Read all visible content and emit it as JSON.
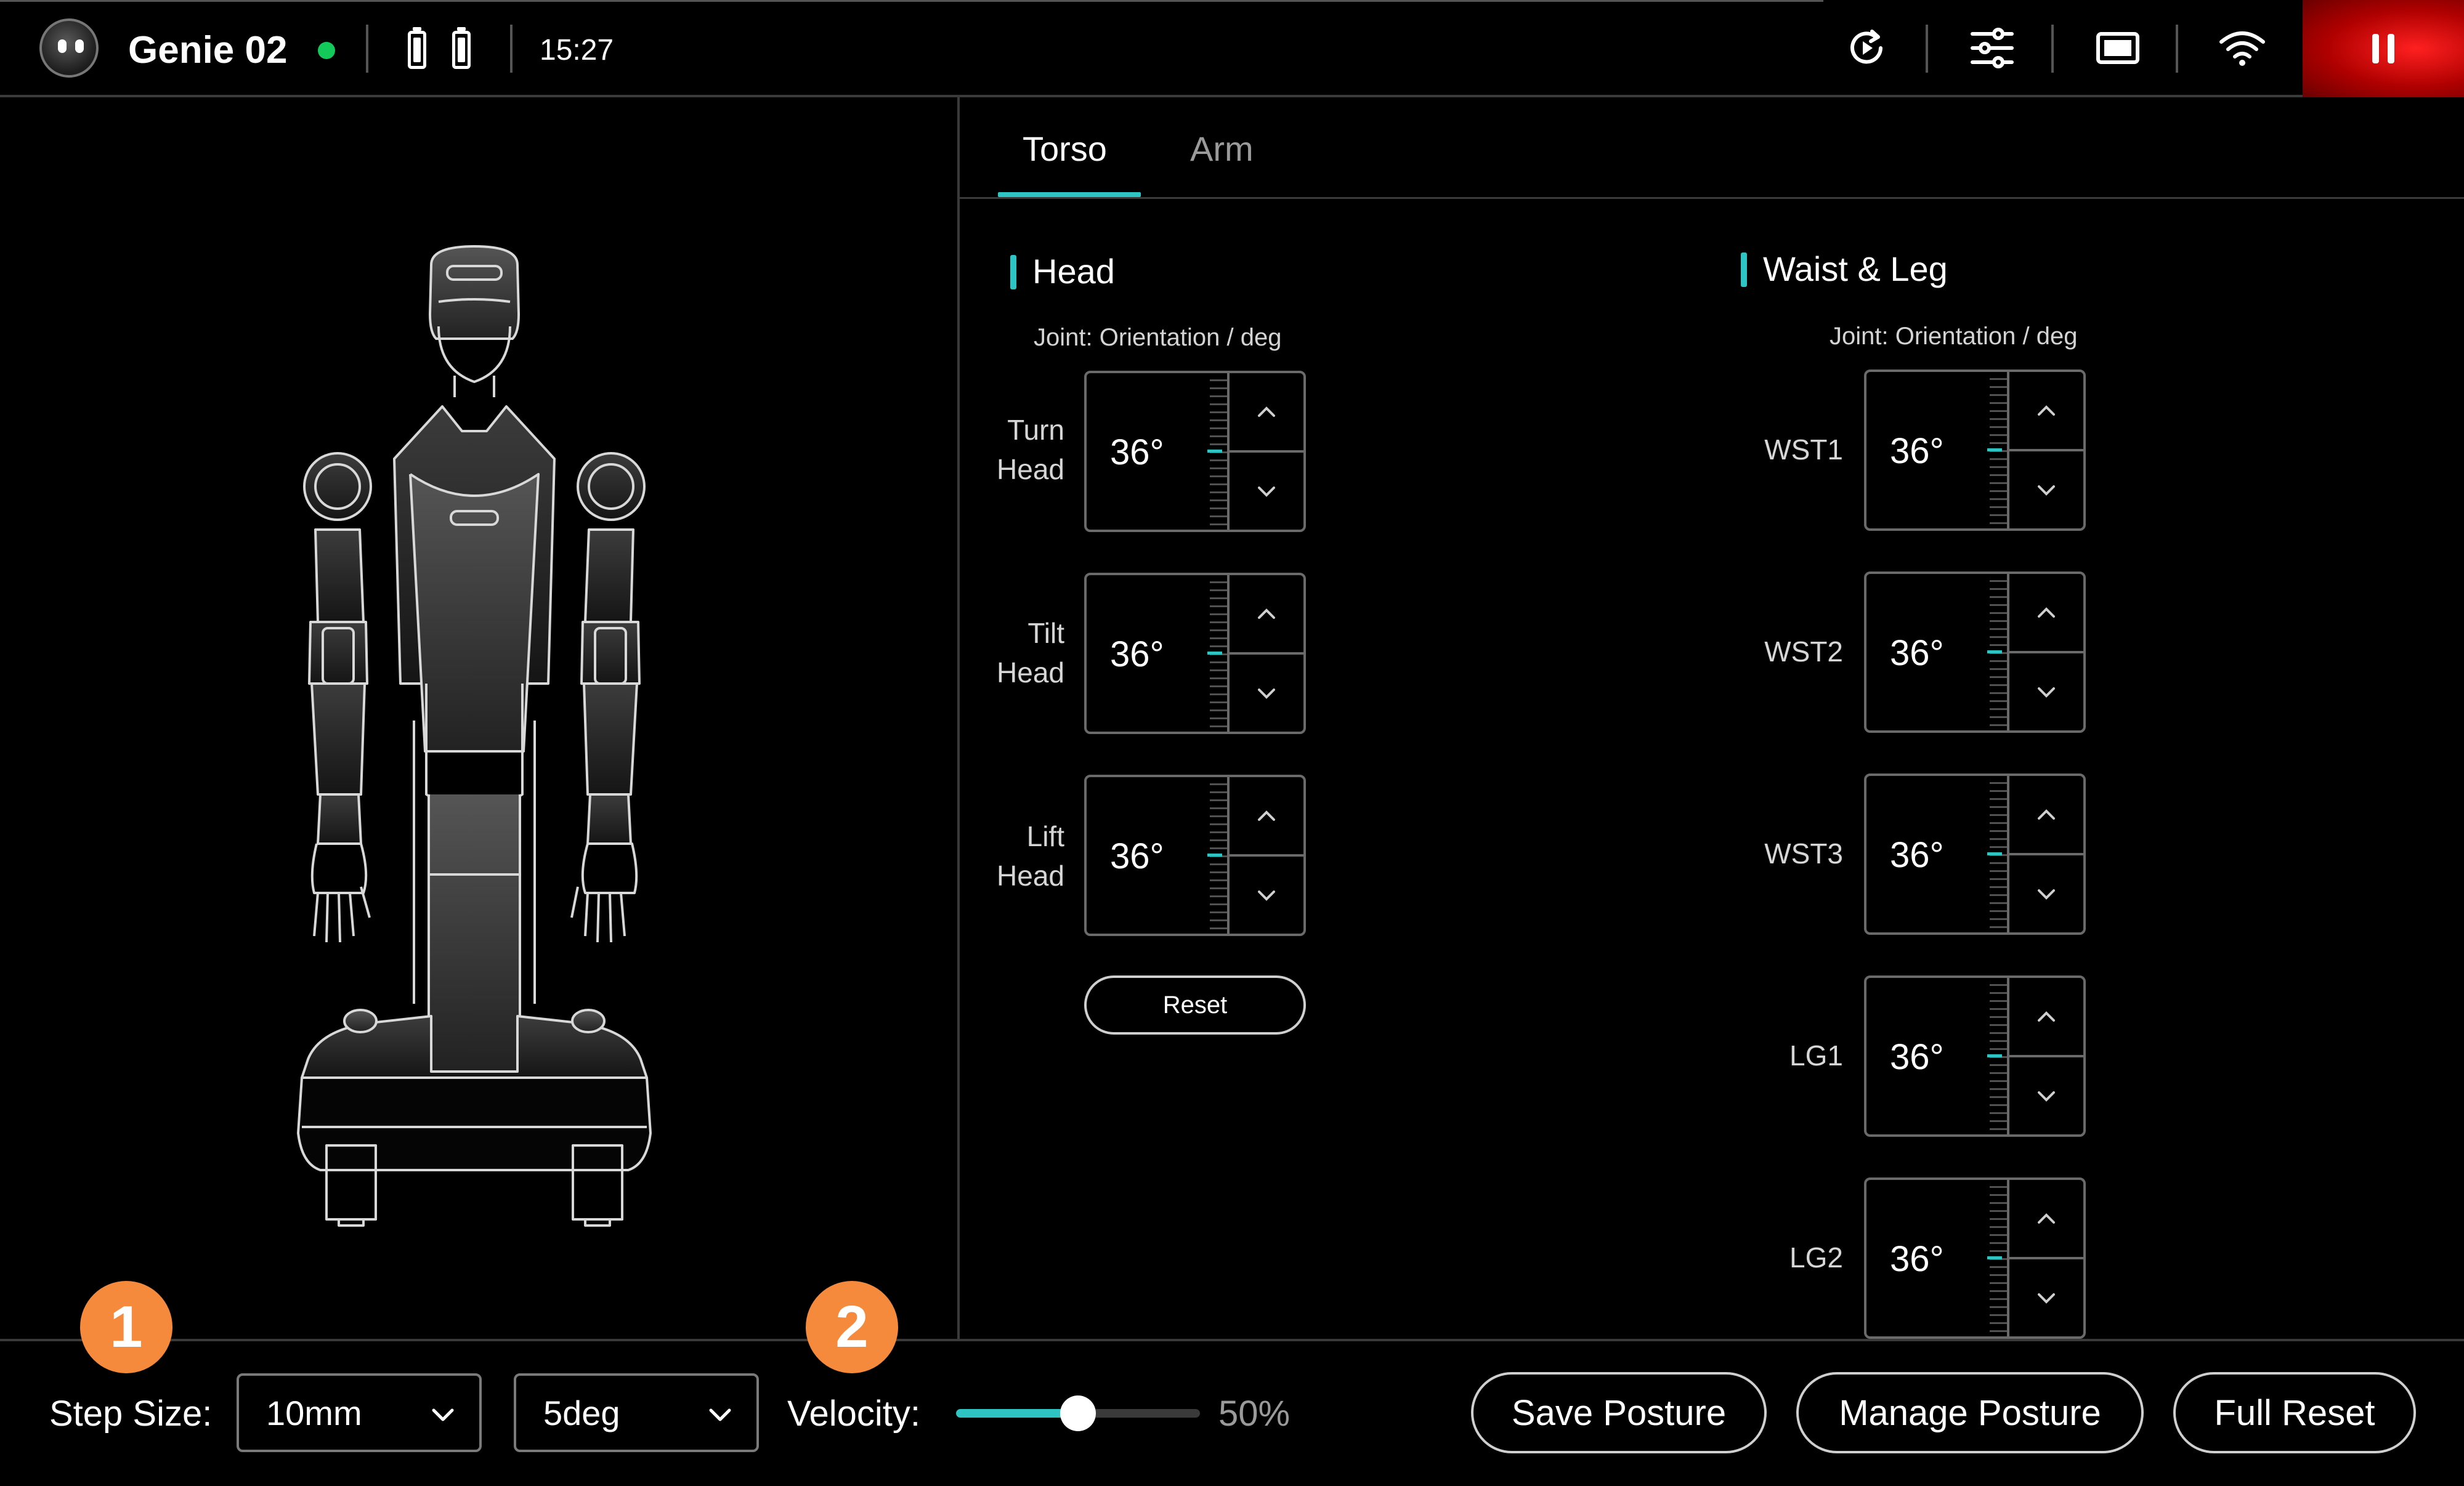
{
  "header": {
    "robot_name": "Genie 02",
    "status_color": "#12c95a",
    "time": "15:27",
    "icons": [
      "robot-logo-icon",
      "battery-icon",
      "battery-icon",
      "replay-icon",
      "settings-sliders-icon",
      "screen-icon",
      "wifi-icon",
      "pause-icon"
    ],
    "pause_color": "#e01010"
  },
  "tabs": [
    {
      "label": "Torso",
      "active": true
    },
    {
      "label": "Arm",
      "active": false
    }
  ],
  "head": {
    "title": "Head",
    "hint": "Joint:  Orientation / deg",
    "joints": [
      {
        "label_line1": "Turn",
        "label_line2": "Head",
        "value": "36°"
      },
      {
        "label_line1": "Tilt",
        "label_line2": "Head",
        "value": "36°"
      },
      {
        "label_line1": "Lift",
        "label_line2": "Head",
        "value": "36°"
      }
    ],
    "reset_label": "Reset"
  },
  "waist_leg": {
    "title": "Waist & Leg",
    "hint": "Joint:  Orientation / deg",
    "joints": [
      {
        "label": "WST1",
        "value": "36°"
      },
      {
        "label": "WST2",
        "value": "36°"
      },
      {
        "label": "WST3",
        "value": "36°"
      },
      {
        "label": "LG1",
        "value": "36°"
      },
      {
        "label": "LG2",
        "value": "36°"
      }
    ]
  },
  "bottom": {
    "badge1": "1",
    "badge2": "2",
    "step_size_label": "Step Size:",
    "step_linear": "10mm",
    "step_angular": "5deg",
    "velocity_label": "Velocity:",
    "velocity_percent": 50,
    "velocity_text": "50%",
    "save_posture": "Save Posture",
    "manage_posture": "Manage Posture",
    "full_reset": "Full Reset"
  },
  "colors": {
    "accent": "#2ec4c4",
    "badge": "#f5893c",
    "status": "#12c95a"
  }
}
